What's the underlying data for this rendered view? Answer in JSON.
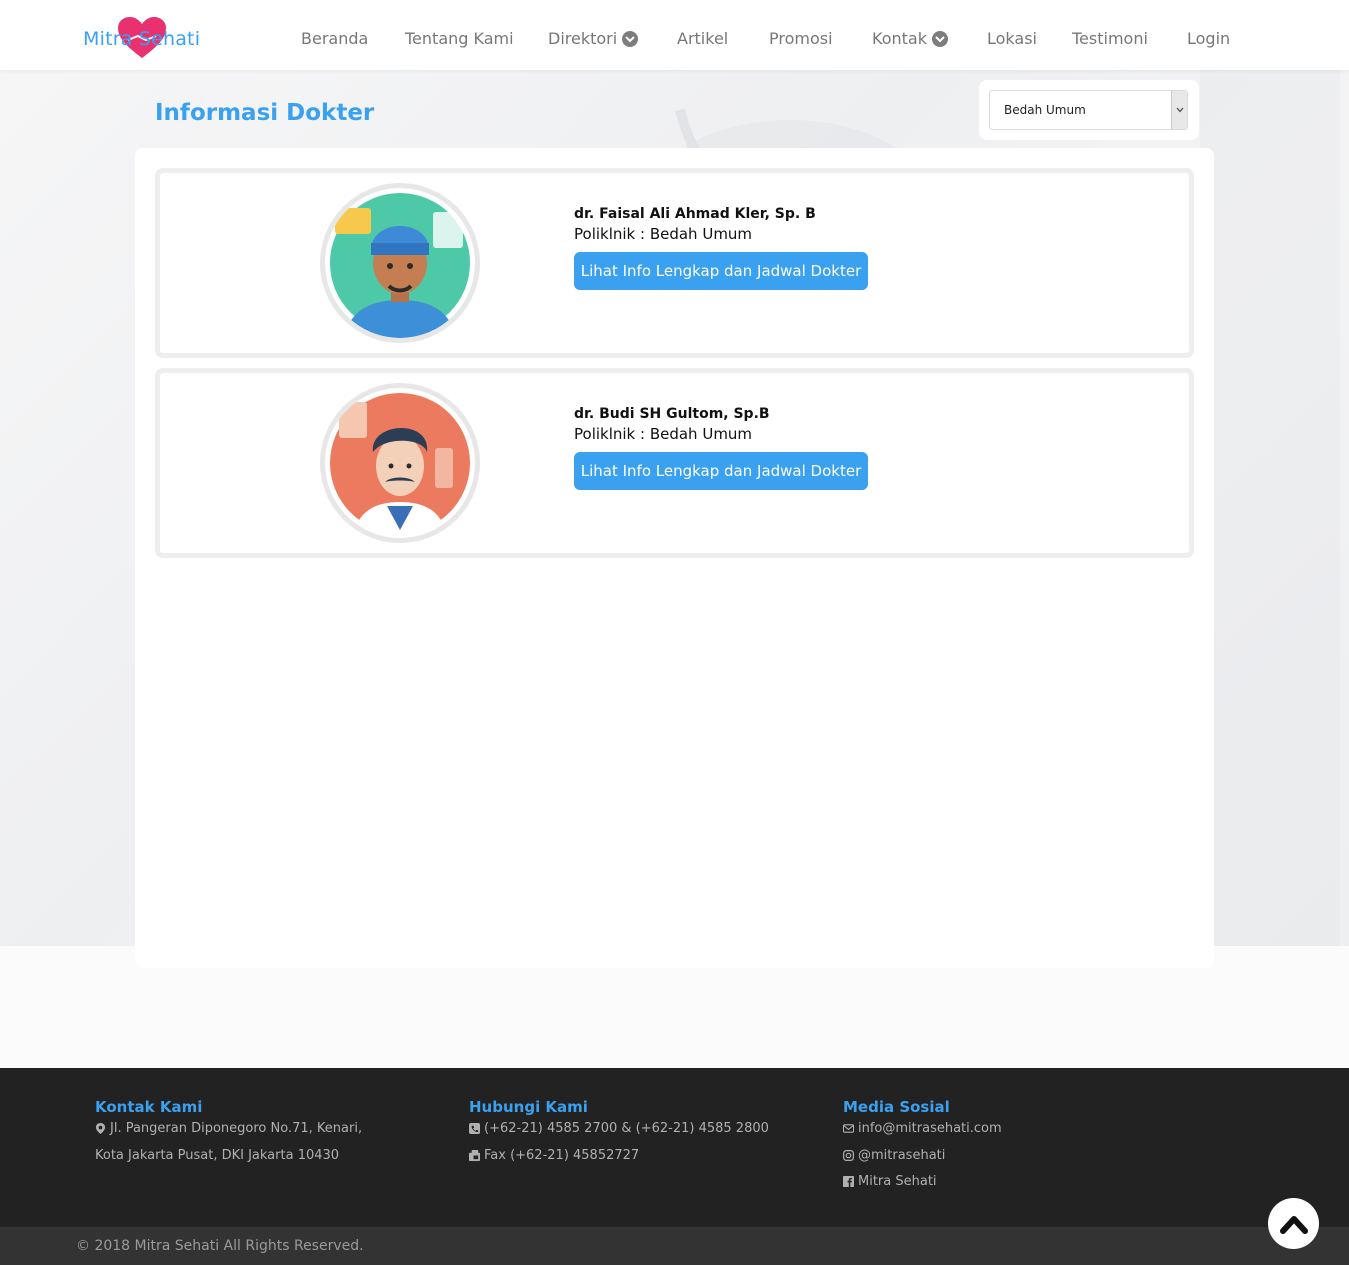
{
  "brand": {
    "name": "Mitra Sehati",
    "accent": "#3aa0f0",
    "heart_color": "#e8316e"
  },
  "nav": {
    "items": [
      {
        "label": "Beranda"
      },
      {
        "label": "Tentang Kami"
      },
      {
        "label": "Direktori",
        "has_dropdown": true
      },
      {
        "label": "Artikel"
      },
      {
        "label": "Promosi"
      },
      {
        "label": "Kontak",
        "has_dropdown": true
      },
      {
        "label": "Lokasi"
      },
      {
        "label": "Testimoni"
      },
      {
        "label": "Login"
      }
    ]
  },
  "main": {
    "title": "Informasi Dokter",
    "filter": {
      "selected": "Bedah Umum"
    },
    "doctors": [
      {
        "name": "dr. Faisal Ali Ahmad Kler, Sp. B",
        "poli": "Poliklnik : Bedah Umum",
        "button": "Lihat Info Lengkap dan Jadwal Dokter",
        "avatar_icon": "doctor-cap-avatar-icon"
      },
      {
        "name": "dr. Budi SH Gultom, Sp.B",
        "poli": "Poliklnik : Bedah Umum",
        "button": "Lihat Info Lengkap dan Jadwal Dokter",
        "avatar_icon": "doctor-mustache-avatar-icon"
      }
    ]
  },
  "footer": {
    "kontak": {
      "title": "Kontak Kami",
      "address1": "Jl. Pangeran Diponegoro No.71, Kenari,",
      "address2": "Kota Jakarta Pusat, DKI Jakarta 10430"
    },
    "hubungi": {
      "title": "Hubungi Kami",
      "phone": "(+62-21) 4585 2700 & (+62-21) 4585 2800",
      "fax": "Fax (+62-21) 45852727"
    },
    "sosial": {
      "title": "Media Sosial",
      "email": "info@mitrasehati.com",
      "instagram": "@mitrasehati",
      "facebook": "Mitra Sehati"
    },
    "copyright": "© 2018 Mitra Sehati All Rights Reserved."
  }
}
